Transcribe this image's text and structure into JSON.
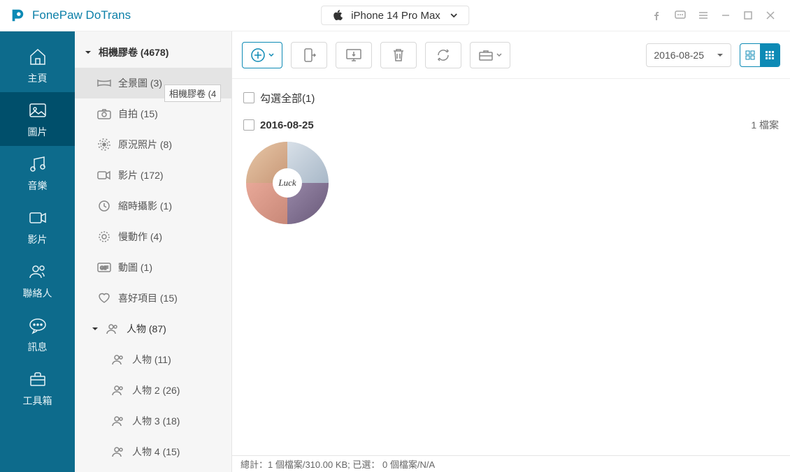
{
  "app": {
    "title": "FonePaw DoTrans"
  },
  "device": {
    "name": "iPhone 14 Pro Max"
  },
  "nav": {
    "home": "主頁",
    "photos": "圖片",
    "music": "音樂",
    "videos": "影片",
    "contacts": "聯絡人",
    "messages": "訊息",
    "toolbox": "工具箱"
  },
  "tree": {
    "camera_roll": "相機膠卷 (4678)",
    "tooltip": "相機膠卷 (4",
    "items": [
      {
        "label": "全景圖 (3)"
      },
      {
        "label": "自拍 (15)"
      },
      {
        "label": "原況照片 (8)"
      },
      {
        "label": "影片 (172)"
      },
      {
        "label": "縮時攝影 (1)"
      },
      {
        "label": "慢動作 (4)"
      },
      {
        "label": "動圖 (1)"
      },
      {
        "label": "喜好項目 (15)"
      }
    ],
    "people": "人物 (87)",
    "people_items": [
      {
        "label": "人物 (11)"
      },
      {
        "label": "人物 2 (26)"
      },
      {
        "label": "人物 3 (18)"
      },
      {
        "label": "人物 4 (15)"
      }
    ]
  },
  "toolbar": {
    "date": "2016-08-25"
  },
  "list": {
    "select_all": "勾選全部(1)",
    "group_date": "2016-08-25",
    "group_count": "1 檔案",
    "thumb_badge": "Luck"
  },
  "status": {
    "text": "總計：1 個檔案/310.00 KB; 已選： 0 個檔案/N/A"
  }
}
